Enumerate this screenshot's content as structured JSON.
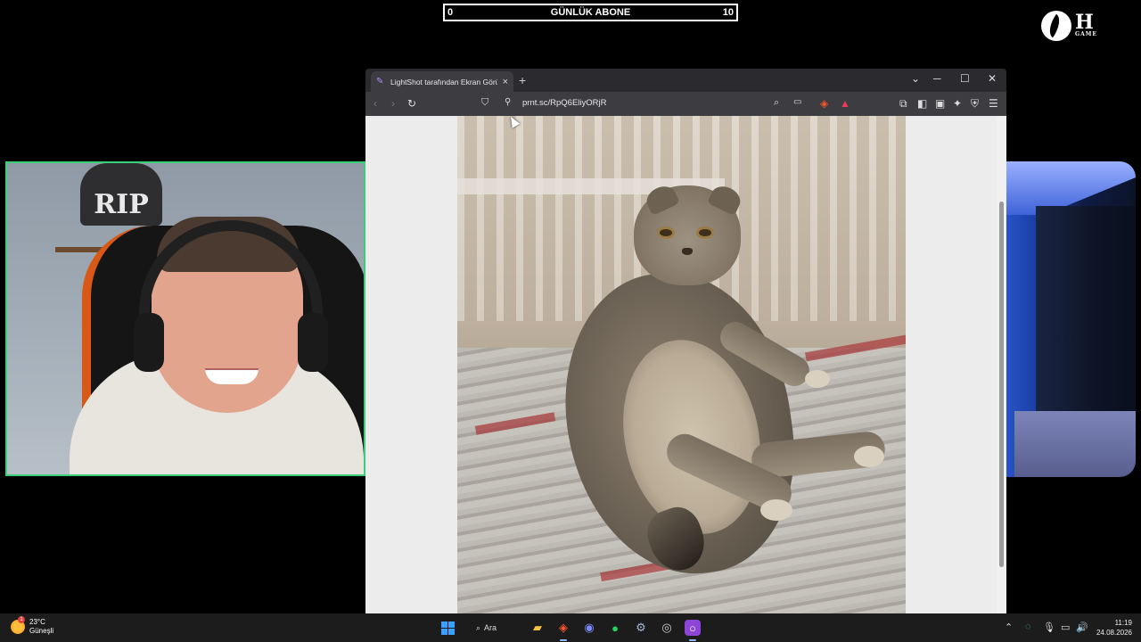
{
  "overlay": {
    "goal_start": "0",
    "goal_title": "GÜNLÜK ABONE",
    "goal_end": "10",
    "logo_mark": "H",
    "logo_sub": "GAME"
  },
  "webcam": {
    "poster_text": "RIP"
  },
  "browser": {
    "tab_title": "LightShot tarafından Ekran Görü",
    "url": "prnt.sc/RpQ6EliyORjR"
  },
  "taskbar": {
    "weather_temp": "23°C",
    "weather_desc": "Güneşli",
    "weather_badge": "1",
    "search_label": "Ara",
    "time": "11:19",
    "date": "24.08.2026"
  },
  "colors": {
    "webcam_border": "#3ad07a",
    "browser_chrome": "#3c3c41",
    "taskbar": "#1c1c1c"
  }
}
